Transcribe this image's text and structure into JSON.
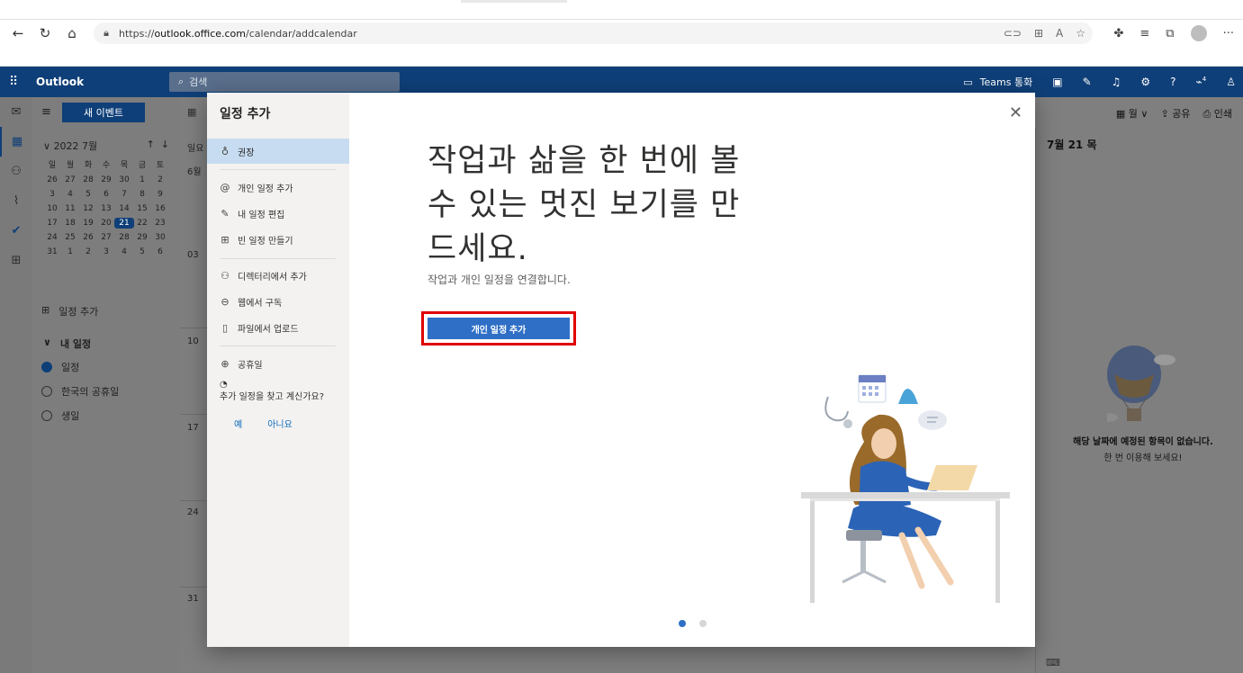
{
  "browser": {
    "url_prefix": "https://",
    "url_host": "outlook.office.com",
    "url_path": "/calendar/addcalendar"
  },
  "header": {
    "brand": "Outlook",
    "search_placeholder": "검색",
    "teams_label": "Teams 통화",
    "notification_count": "4"
  },
  "folder": {
    "new_event": "새 이벤트",
    "month_label": "2022 7월",
    "weekdays": [
      "일",
      "월",
      "화",
      "수",
      "목",
      "금",
      "토"
    ],
    "days": [
      "26",
      "27",
      "28",
      "29",
      "30",
      "1",
      "2",
      "3",
      "4",
      "5",
      "6",
      "7",
      "8",
      "9",
      "10",
      "11",
      "12",
      "13",
      "14",
      "15",
      "16",
      "17",
      "18",
      "19",
      "20",
      "21",
      "22",
      "23",
      "24",
      "25",
      "26",
      "27",
      "28",
      "29",
      "30",
      "31",
      "1",
      "2",
      "3",
      "4",
      "5",
      "6"
    ],
    "today": "21",
    "add_calendar": "일정 추가",
    "my_calendars": "내 일정",
    "calendars": [
      {
        "label": "일정",
        "checked": true
      },
      {
        "label": "한국의 공휴일",
        "checked": false
      },
      {
        "label": "생일",
        "checked": false
      }
    ]
  },
  "main": {
    "day_header": "7월 21 목",
    "week_col_label": "일요",
    "first_date": "6월",
    "week_numbers": [
      "03",
      "10",
      "17",
      "24",
      "31"
    ],
    "tools": {
      "view": "월",
      "share": "공유",
      "print": "인쇄"
    },
    "empty_title": "해당 날짜에 예정된 항목이 없습니다.",
    "empty_sub": "한 번 이용해 보세요!"
  },
  "dialog": {
    "title": "일정 추가",
    "nav": [
      {
        "label": "권장",
        "icon": "lightbulb-icon",
        "selected": true
      },
      {
        "label": "개인 일정 추가",
        "icon": "at-icon"
      },
      {
        "label": "내 일정 편집",
        "icon": "edit-calendar-icon"
      },
      {
        "label": "빈 일정 만들기",
        "icon": "new-calendar-icon"
      },
      {
        "label": "디렉터리에서 추가",
        "icon": "people-icon"
      },
      {
        "label": "웹에서 구독",
        "icon": "link-icon"
      },
      {
        "label": "파일에서 업로드",
        "icon": "file-icon"
      },
      {
        "label": "공휴일",
        "icon": "globe-icon"
      }
    ],
    "prompt": "추가 일정을 찾고 계신가요?",
    "yes": "예",
    "no": "아니요",
    "headline": "작업과 삶을 한 번에 볼 수 있는 멋진 보기를 만드세요.",
    "subtext": "작업과 개인 일정을 연결합니다.",
    "primary_button": "개인 일정 추가",
    "page_index": 1,
    "page_count": 2,
    "colors": {
      "accent": "#2f6fc6",
      "highlight": "#e00000",
      "header": "#0f3f78"
    }
  }
}
